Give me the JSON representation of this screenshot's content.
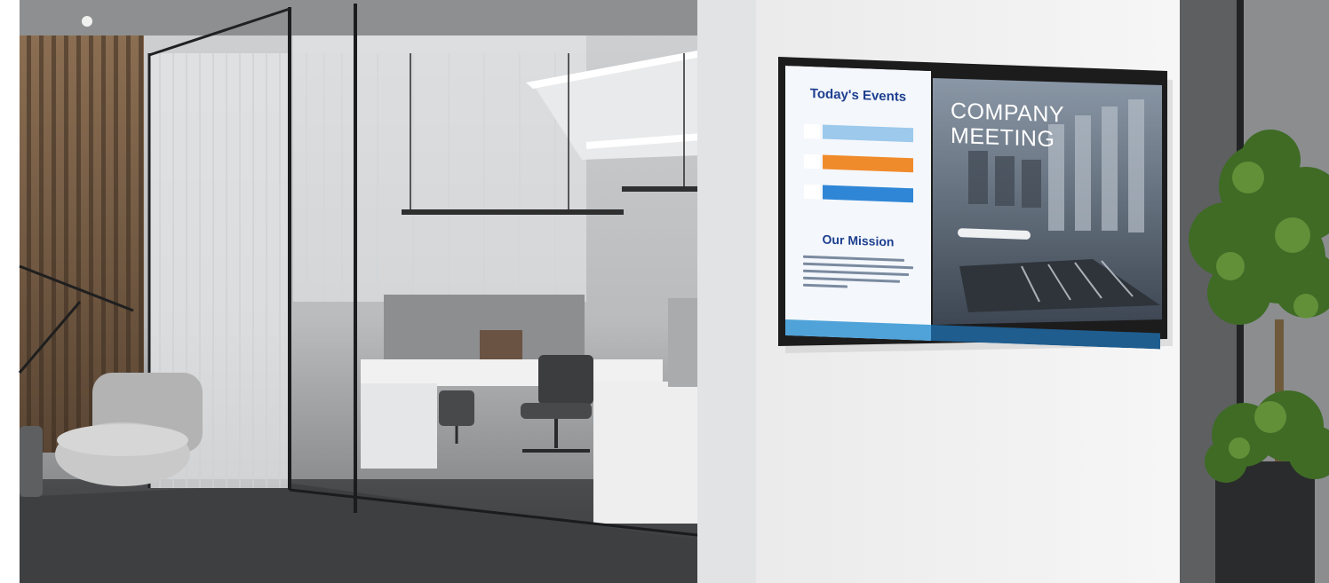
{
  "screen": {
    "events_title": "Today's Events",
    "mission_title": "Our Mission",
    "company_title_line1": "COMPANY",
    "company_title_line2": "MEETING"
  },
  "colors": {
    "event_light_blue": "#9cc9ec",
    "event_orange": "#f08b2b",
    "event_blue": "#2f86d6",
    "heading_navy": "#1d3f8f",
    "footer_blue": "#1f5d8f"
  }
}
